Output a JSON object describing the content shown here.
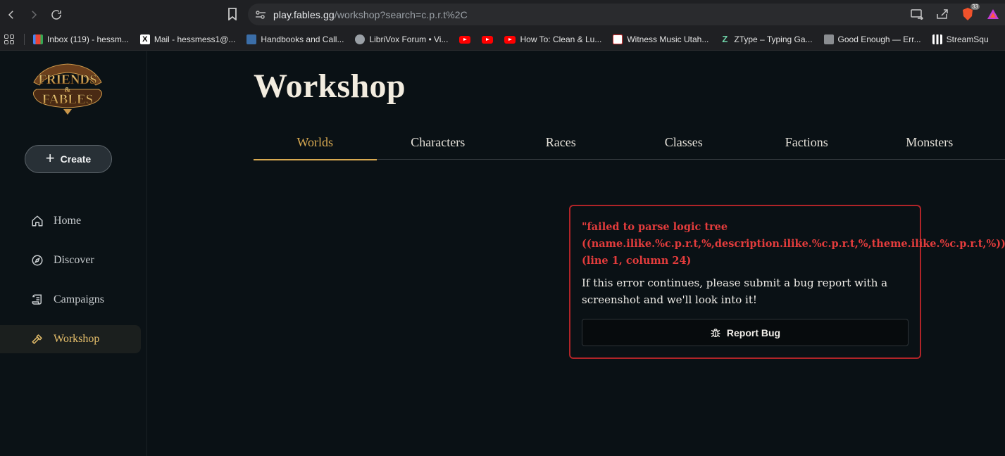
{
  "browser": {
    "url_host": "play.fables.gg",
    "url_path": "/workshop?search=c.p.r.t%2C",
    "brave_badge": "33"
  },
  "bookmarks": [
    {
      "label": "Inbox (119) - hessm...",
      "icon": "gmail-icon"
    },
    {
      "label": "Mail - hessmess1@...",
      "icon": "x-icon"
    },
    {
      "label": "Handbooks and Call...",
      "icon": "bookmark-icon"
    },
    {
      "label": "LibriVox Forum • Vi...",
      "icon": "globe-icon"
    },
    {
      "label": "",
      "icon": "youtube-icon"
    },
    {
      "label": "",
      "icon": "youtube-icon"
    },
    {
      "label": "How To: Clean & Lu...",
      "icon": "youtube-icon"
    },
    {
      "label": "Witness Music Utah...",
      "icon": "chart-icon"
    },
    {
      "label": "ZType – Typing Ga...",
      "icon": "z-icon"
    },
    {
      "label": "Good Enough — Err...",
      "icon": "cube-icon"
    },
    {
      "label": "StreamSqu",
      "icon": "bars-icon"
    }
  ],
  "sidebar": {
    "logo_text_1": "FRIENDS",
    "logo_text_2": "&",
    "logo_text_3": "FABLES",
    "create_label": "Create",
    "items": [
      {
        "label": "Home",
        "icon": "home-icon"
      },
      {
        "label": "Discover",
        "icon": "compass-icon"
      },
      {
        "label": "Campaigns",
        "icon": "scroll-icon"
      },
      {
        "label": "Workshop",
        "icon": "hammer-icon"
      }
    ]
  },
  "main": {
    "title": "Workshop",
    "tabs": [
      "Worlds",
      "Characters",
      "Races",
      "Classes",
      "Factions",
      "Monsters"
    ],
    "active_tab": "Worlds"
  },
  "error": {
    "title": "\"failed to parse logic tree\n((name.ilike.%c.p.r.t,%,description.ilike.%c.p.r.t,%,theme.ilike.%c.p.r.t,%))\"\n(line 1, column 24)",
    "message": "If this error continues, please submit a bug report with a screenshot and we'll look into it!",
    "button_label": "Report Bug"
  },
  "colors": {
    "accent_gold": "#d8a951",
    "error_red": "#e23c3c",
    "background": "#0a1115"
  }
}
